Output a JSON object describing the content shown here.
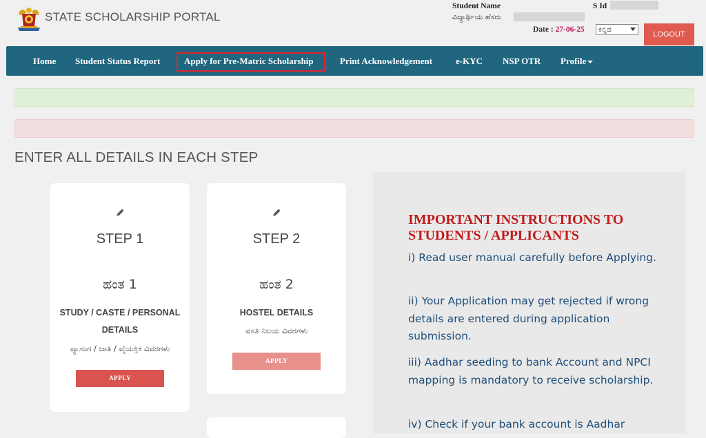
{
  "header": {
    "portal_title": "STATE SCHOLARSHIP PORTAL",
    "student_name_label": "Student Name",
    "student_name_label_kn": "ವಿದ್ಯಾರ್ಥಿಯ ಹೆಸರು",
    "sid_label": "S Id",
    "date_label": "Date : ",
    "date_value": "27-06-25",
    "language_selected": "ಕನ್ನಡ",
    "logout_label": "LOGOUT"
  },
  "nav": {
    "items": [
      {
        "label": "Home"
      },
      {
        "label": "Student Status Report"
      },
      {
        "label": "Apply for Pre-Matric Scholarship"
      },
      {
        "label": "Print Acknowledgement"
      },
      {
        "label": "e-KYC"
      },
      {
        "label": "NSP OTR"
      },
      {
        "label": "Profile"
      }
    ]
  },
  "main": {
    "heading": "ENTER ALL DETAILS IN EACH STEP",
    "steps": [
      {
        "title": "STEP 1",
        "title_kn": "ಹಂತ 1",
        "desc_line1": "STUDY / CASTE / PERSONAL",
        "desc_line2": "DETAILS",
        "desc_kn": "ವ್ಯಾಸಂಗ / ಜಾತಿ / ವೈಯಕ್ತಿಕ ವಿವರಗಳು",
        "button": "APPLY"
      },
      {
        "title": "STEP 2",
        "title_kn": "ಹಂತ 2",
        "desc_line1": "HOSTEL DETAILS",
        "desc_kn": "ವಸತಿ ನಿಲಯ ವಿವರಗಳು",
        "button": "APPLY"
      }
    ]
  },
  "instructions": {
    "title": "IMPORTANT INSTRUCTIONS TO STUDENTS / APPLICANTS",
    "items": [
      "i) Read user manual carefully before Applying.",
      "ii) Your Application may get rejected if wrong details are entered during application submission.",
      "iii) Aadhar seeding to bank Account and NPCI mapping is mandatory to receive scholarship.",
      "iv) Check if your bank account is Aadhar"
    ]
  },
  "colors": {
    "navbar": "#20667f",
    "nav_highlight_border": "#e0252f",
    "logout": "#e05a50",
    "apply_active": "#d9534f",
    "apply_disabled": "#e8908c",
    "instructions_title": "#c11b1b",
    "instructions_text": "#1f4e79",
    "date_value": "#c2185b"
  }
}
